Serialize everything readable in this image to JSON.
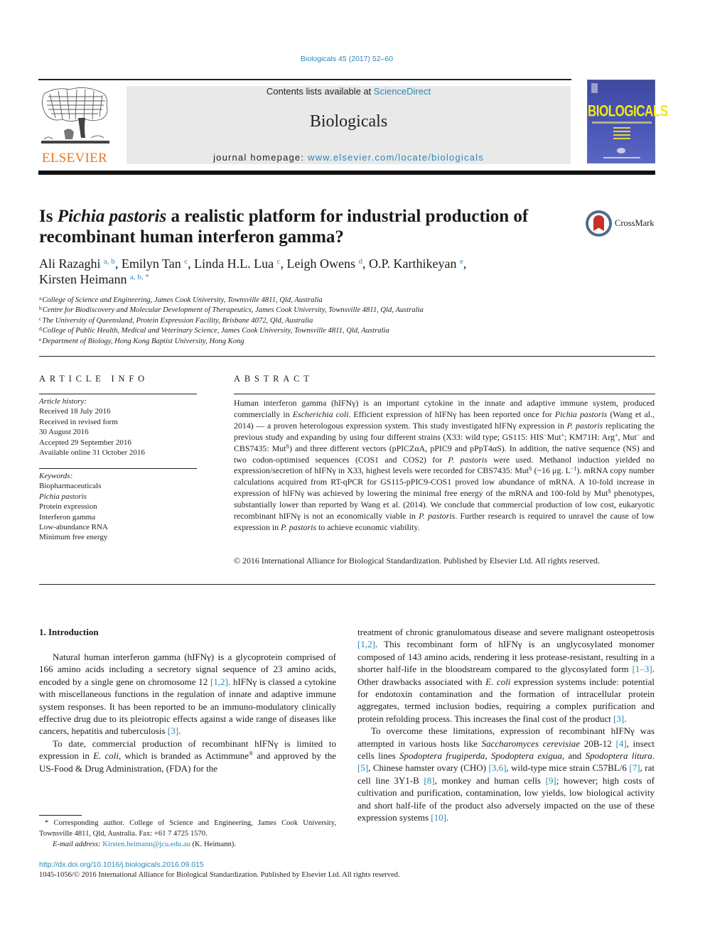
{
  "journal_ref": "Biologicals 45 (2017) 52–60",
  "header": {
    "publisher_logo": "ELSEVIER",
    "contents_prefix": "Contents lists available at ",
    "contents_link": "ScienceDirect",
    "journal_name": "Biologicals",
    "homepage_prefix": "journal homepage: ",
    "homepage_link": "www.elsevier.com/locate/biologicals",
    "cover_title": "BIOLOGICALS",
    "colors": {
      "accent_link": "#2a88b8",
      "elsevier_orange": "#e87722",
      "cover_blue": "#4a56b5",
      "cover_yellow": "#f3e81a"
    }
  },
  "article": {
    "title_prefix": "Is ",
    "title_italic": "Pichia pastoris",
    "title_suffix": " a realistic platform for industrial production of recombinant human interferon gamma?",
    "crossmark_label": "CrossMark",
    "authors": [
      {
        "name": "Ali Razaghi",
        "sup": "a, b",
        "sep": ", "
      },
      {
        "name": "Emilyn Tan",
        "sup": "c",
        "sep": ", "
      },
      {
        "name": "Linda H.L. Lua",
        "sup": "c",
        "sep": ", "
      },
      {
        "name": "Leigh Owens",
        "sup": "d",
        "sep": ", "
      },
      {
        "name": "O.P. Karthikeyan",
        "sup": "e",
        "sep": ","
      },
      {
        "name": "Kirsten Heimann",
        "sup": "a, b, *",
        "sep": ""
      }
    ],
    "affiliations": [
      {
        "key": "a",
        "text": "College of Science and Engineering, James Cook University, Townsville 4811, Qld, Australia"
      },
      {
        "key": "b",
        "text": "Centre for Biodiscovery and Molecular Development of Therapeutics, James Cook University, Townsville 4811, Qld, Australia"
      },
      {
        "key": "c",
        "text": "The University of Queensland, Protein Expression Facility, Brisbane 4072, Qld, Australia"
      },
      {
        "key": "d",
        "text": "College of Public Health, Medical and Veterinary Science, James Cook University, Townsville 4811, Qld, Australia"
      },
      {
        "key": "e",
        "text": "Department of Biology, Hong Kong Baptist University, Hong Kong"
      }
    ]
  },
  "article_info": {
    "label": "ARTICLE INFO",
    "history_heading": "Article history:",
    "history": [
      "Received 18 July 2016",
      "Received in revised form",
      "30 August 2016",
      "Accepted 29 September 2016",
      "Available online 31 October 2016"
    ],
    "keywords_heading": "Keywords:",
    "keywords": [
      "Biopharmaceuticals",
      "Pichia pastoris",
      "Protein expression",
      "Interferon gamma",
      "Low-abundance RNA",
      "Minimum free energy"
    ]
  },
  "abstract": {
    "label": "ABSTRACT",
    "segments": [
      {
        "t": "Human interferon gamma (hIFNγ) is an important cytokine in the innate and adaptive immune system, produced commercially in "
      },
      {
        "t": "Escherichia coli",
        "i": true
      },
      {
        "t": ". Efficient expression of hIFNγ has been reported once for "
      },
      {
        "t": "Pichia pastoris",
        "i": true
      },
      {
        "t": " (Wang et al., 2014) — a proven heterologous expression system. This study investigated hIFNγ expression in "
      },
      {
        "t": "P. pastoris",
        "i": true
      },
      {
        "t": " replicating the previous study and expanding by using four different strains (X33: wild type; GS115: HIS"
      },
      {
        "t": "−",
        "sup": true
      },
      {
        "t": "Mut"
      },
      {
        "t": "+",
        "sup": true
      },
      {
        "t": "; KM71H: Arg"
      },
      {
        "t": "+",
        "sup": true
      },
      {
        "t": ", Mut"
      },
      {
        "t": "−",
        "sup": true
      },
      {
        "t": " and CBS7435: Mut"
      },
      {
        "t": "S",
        "sup": true
      },
      {
        "t": ") and three different vectors (pPICZαA, pPIC9 and pPpT4αS). In addition, the native sequence (NS) and two codon-optimised sequences (COS1 and COS2) for "
      },
      {
        "t": "P. pastoris",
        "i": true
      },
      {
        "t": " were used. Methanol induction yielded no expression/secretion of hIFNγ in X33, highest levels were recorded for CBS7435: Mut"
      },
      {
        "t": "S",
        "sup": true
      },
      {
        "t": " (~16 μg. L"
      },
      {
        "t": "−1",
        "sup": true
      },
      {
        "t": "). mRNA copy number calculations acquired from RT-qPCR for GS115-pPIC9-COS1 proved low abundance of mRNA. A 10-fold increase in expression of hIFNγ was achieved by lowering the minimal free energy of the mRNA and 100-fold by Mut"
      },
      {
        "t": "S",
        "sup": true
      },
      {
        "t": " phenotypes, substantially lower than reported by Wang et al. (2014). We conclude that commercial production of low cost, eukaryotic recombinant hIFNγ is not an economically viable in "
      },
      {
        "t": "P. pastoris",
        "i": true
      },
      {
        "t": ". Further research is required to unravel the cause of low expression in "
      },
      {
        "t": "P. pastoris",
        "i": true
      },
      {
        "t": " to achieve economic viability."
      }
    ],
    "copyright": "© 2016 International Alliance for Biological Standardization. Published by Elsevier Ltd. All rights reserved."
  },
  "introduction": {
    "heading": "1.  Introduction",
    "left_paragraphs": [
      [
        {
          "t": "Natural human interferon gamma (hIFNγ) is a glycoprotein comprised of 166 amino acids including a secretory signal sequence of 23 amino acids, encoded by a single gene on chromosome 12 "
        },
        {
          "t": "[1,2]",
          "ref": true
        },
        {
          "t": ". hIFNγ is classed a cytokine with miscellaneous functions in the regulation of innate and adaptive immune system responses. It has been reported to be an immuno-modulatory clinically effective drug due to its pleiotropic effects against a wide range of diseases like cancers, hepatitis and tuberculosis "
        },
        {
          "t": "[3]",
          "ref": true
        },
        {
          "t": "."
        }
      ],
      [
        {
          "t": "To date, commercial production of recombinant hIFNγ is limited to expression in "
        },
        {
          "t": "E. coli",
          "i": true
        },
        {
          "t": ", which is branded as Actimmune"
        },
        {
          "t": "®",
          "sup": true
        },
        {
          "t": " and approved by the US-Food & Drug Administration, (FDA) for the"
        }
      ]
    ],
    "right_paragraphs": [
      [
        {
          "t": "treatment of chronic granulomatous disease and severe malignant osteopetrosis "
        },
        {
          "t": "[1,2]",
          "ref": true
        },
        {
          "t": ". This recombinant form of hIFNγ is an unglycosylated monomer composed of 143 amino acids, rendering it less protease-resistant, resulting in a shorter half-life in the bloodstream compared to the glycosylated form "
        },
        {
          "t": "[1–3]",
          "ref": true
        },
        {
          "t": ". Other drawbacks associated with "
        },
        {
          "t": "E. coli",
          "i": true
        },
        {
          "t": " expression systems include: potential for endotoxin contamination and the formation of intracellular protein aggregates, termed inclusion bodies, requiring a complex purification and protein refolding process. This increases the final cost of the product "
        },
        {
          "t": "[3]",
          "ref": true
        },
        {
          "t": "."
        }
      ],
      [
        {
          "t": "To overcome these limitations, expression of recombinant hIFNγ was attempted in various hosts like "
        },
        {
          "t": "Saccharomyces cerevisiae",
          "i": true
        },
        {
          "t": " 20B-12 "
        },
        {
          "t": "[4]",
          "ref": true
        },
        {
          "t": ", insect cells lines "
        },
        {
          "t": "Spodoptera frugiperda",
          "i": true
        },
        {
          "t": ", "
        },
        {
          "t": "Spodoptera exigua",
          "i": true
        },
        {
          "t": ", and "
        },
        {
          "t": "Spodoptera litura",
          "i": true
        },
        {
          "t": ". "
        },
        {
          "t": "[5]",
          "ref": true
        },
        {
          "t": ", Chinese hamster ovary (CHO) "
        },
        {
          "t": "[3,6]",
          "ref": true
        },
        {
          "t": ", wild-type mice strain C57BL/6 "
        },
        {
          "t": "[7]",
          "ref": true
        },
        {
          "t": ", rat cell line 3Y1-B "
        },
        {
          "t": "[8]",
          "ref": true
        },
        {
          "t": ", monkey and human cells "
        },
        {
          "t": "[9]",
          "ref": true
        },
        {
          "t": "; however; high costs of cultivation and purification, contamination, low yields, low biological activity and short half-life of the product also adversely impacted on the use of these expression systems "
        },
        {
          "t": "[10]",
          "ref": true
        },
        {
          "t": "."
        }
      ]
    ]
  },
  "footnote": {
    "corresponding": "* Corresponding author. College of Science and Engineering, James Cook University, Townsville 4811, Qld, Australia. Fax: +61 7 4725 1570.",
    "email_label": "E-mail address:",
    "email": "Kirsten.heimann@jcu.edu.au",
    "email_suffix": " (K. Heimann)."
  },
  "doi_link": "http://dx.doi.org/10.1016/j.biologicals.2016.09.015",
  "issn_line": "1045-1056/© 2016 International Alliance for Biological Standardization. Published by Elsevier Ltd. All rights reserved."
}
